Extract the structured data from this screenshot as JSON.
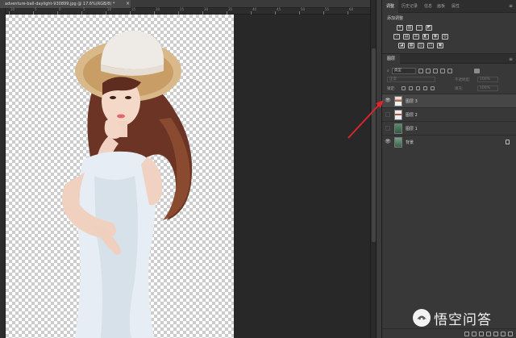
{
  "document": {
    "tab_title": "adventure-ball-daylight-930899.jpg @ 17.6%(RGB/8) *",
    "tab_close": "×",
    "ruler_numbers": [
      "10",
      "5",
      "0",
      "5",
      "10",
      "15",
      "20",
      "25",
      "30",
      "35",
      "40",
      "45",
      "50",
      "55",
      "60"
    ]
  },
  "top_panel": {
    "tabs": [
      "调整",
      "历史记录",
      "信息",
      "画板",
      "属性"
    ],
    "active_tab_index": 0,
    "menu_icon": "panel-menu-icon",
    "adjust_title": "添加调整",
    "rows": [
      [
        "brightness-icon",
        "levels-icon",
        "curves-icon",
        "exposure-icon"
      ],
      [
        "vibrance-icon",
        "hue-icon",
        "color-balance-icon",
        "bw-icon",
        "photo-filter-icon",
        "channel-mixer-icon"
      ],
      [
        "invert-icon",
        "posterize-icon",
        "threshold-icon",
        "gradient-map-icon",
        "selective-color-icon"
      ]
    ]
  },
  "layers_panel": {
    "tab_label": "图层",
    "filter": {
      "label": "类型"
    },
    "blend_mode": "正常",
    "opacity_label": "不透明度:",
    "opacity_value": "100%",
    "lock_label": "锁定:",
    "fill_label": "填充:",
    "fill_value": "100%",
    "layers": [
      {
        "name": "图层 3",
        "visible": true,
        "selected": true,
        "locked": false
      },
      {
        "name": "图层 2",
        "visible": false,
        "selected": false,
        "locked": false
      },
      {
        "name": "图层 1",
        "visible": false,
        "selected": false,
        "locked": false
      },
      {
        "name": "背景",
        "visible": true,
        "selected": false,
        "locked": true
      }
    ]
  },
  "annotation": {
    "arrow_color": "#d9262c"
  },
  "watermark": {
    "text": "悟空问答"
  }
}
